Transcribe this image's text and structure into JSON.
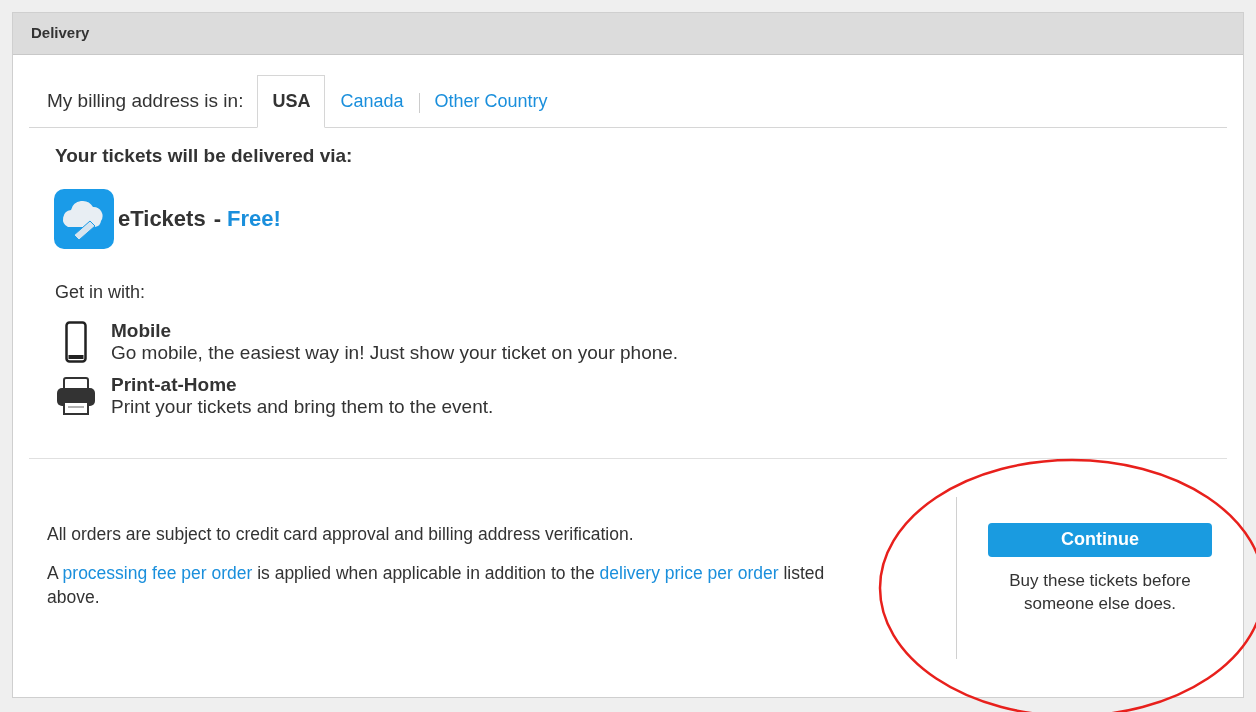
{
  "panel": {
    "title": "Delivery"
  },
  "billing": {
    "label": "My billing address is in:",
    "tabs": [
      {
        "label": "USA",
        "selected": true
      },
      {
        "label": "Canada",
        "selected": false
      },
      {
        "label": "Other Country",
        "selected": false
      }
    ]
  },
  "delivery": {
    "heading": "Your tickets will be delivered via:",
    "method": "eTickets",
    "separator": "-",
    "price": "Free!"
  },
  "get_in": {
    "label": "Get in with:",
    "options": [
      {
        "kind": "mobile",
        "title": "Mobile",
        "description": "Go mobile, the easiest way in! Just show your ticket on your phone."
      },
      {
        "kind": "print",
        "title": "Print-at-Home",
        "description": "Print your tickets and bring them to the event."
      }
    ]
  },
  "footer": {
    "notice": "All orders are subject to credit card approval and billing address verification.",
    "fee_note": [
      {
        "text": "A ",
        "link": false
      },
      {
        "text": "processing fee per order",
        "link": true
      },
      {
        "text": " is applied when applicable in addition to the ",
        "link": false
      },
      {
        "text": "delivery price per order",
        "link": true
      },
      {
        "text": " listed above.",
        "link": false
      }
    ],
    "button": "Continue",
    "hint": "Buy these tickets before someone else does."
  },
  "annotation": {
    "kind": "ellipse"
  }
}
